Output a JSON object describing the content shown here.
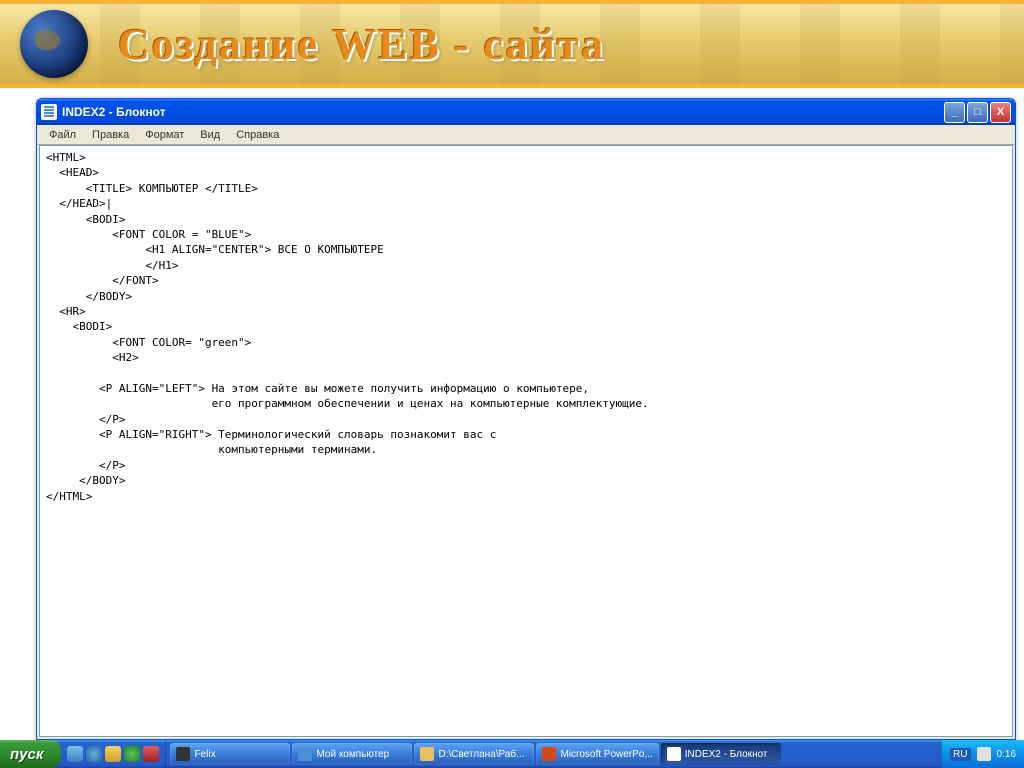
{
  "banner": {
    "title": "Создание WEB - сайта"
  },
  "window": {
    "title": "INDEX2 - Блокнот",
    "menus": [
      "Файл",
      "Правка",
      "Формат",
      "Вид",
      "Справка"
    ],
    "controls": {
      "minimize": "_",
      "maximize": "□",
      "close": "X"
    }
  },
  "editor": {
    "content": "<HTML>\n  <HEAD>\n      <TITLE> КОМПЬЮТЕР </TITLE>\n  </HEAD>|\n      <BODI>\n          <FONT COLOR = \"BLUE\">\n               <H1 ALIGN=\"CENTER\"> ВСЕ О КОМПЬЮТЕРЕ\n               </H1>\n          </FONT>\n      </BODY>\n  <HR>\n    <BODI>\n          <FONT COLOR= \"green\">\n          <H2>\n\n        <P ALIGN=\"LEFT\"> На этом сайте вы можете получить информацию о компьютере,\n                         его программном обеспечении и ценах на компьютерные комплектующие.\n        </P>\n        <P ALIGN=\"RIGHT\"> Терминологический словарь познакомит вас с\n                          компьютерными терминами.\n        </P>\n     </BODY>\n</HTML>"
  },
  "taskbar": {
    "start": "пуск",
    "items": [
      {
        "label": "Felix",
        "color": "#333"
      },
      {
        "label": "Мой компьютер",
        "color": "#4a90d9"
      },
      {
        "label": "D:\\Светлана\\Раб...",
        "color": "#e8c060"
      },
      {
        "label": "Microsoft PowerPo...",
        "color": "#d04a1a"
      },
      {
        "label": "INDEX2 - Блокнот",
        "color": "#4a90d9",
        "active": true
      }
    ],
    "lang": "RU",
    "time": "0:16"
  }
}
